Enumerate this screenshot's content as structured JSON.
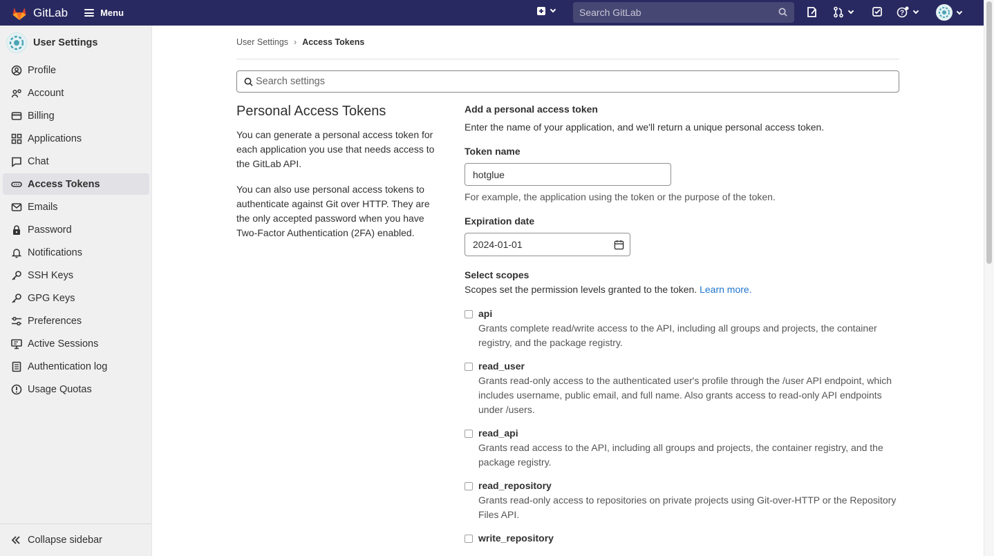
{
  "navbar": {
    "brand": "GitLab",
    "menu_label": "Menu",
    "search_placeholder": "Search GitLab",
    "icons": [
      "plus-square-icon",
      "search-icon",
      "issues-icon",
      "merge-request-icon",
      "todo-icon",
      "help-icon",
      "avatar-icon"
    ]
  },
  "sidebar": {
    "title": "User Settings",
    "items": [
      {
        "label": "Profile",
        "icon": "profile-icon"
      },
      {
        "label": "Account",
        "icon": "account-icon"
      },
      {
        "label": "Billing",
        "icon": "billing-icon"
      },
      {
        "label": "Applications",
        "icon": "applications-icon"
      },
      {
        "label": "Chat",
        "icon": "chat-icon"
      },
      {
        "label": "Access Tokens",
        "icon": "token-icon"
      },
      {
        "label": "Emails",
        "icon": "mail-icon"
      },
      {
        "label": "Password",
        "icon": "lock-icon"
      },
      {
        "label": "Notifications",
        "icon": "bell-icon"
      },
      {
        "label": "SSH Keys",
        "icon": "key-icon"
      },
      {
        "label": "GPG Keys",
        "icon": "key-icon"
      },
      {
        "label": "Preferences",
        "icon": "preferences-icon"
      },
      {
        "label": "Active Sessions",
        "icon": "monitor-icon"
      },
      {
        "label": "Authentication log",
        "icon": "log-icon"
      },
      {
        "label": "Usage Quotas",
        "icon": "quota-icon"
      }
    ],
    "active": "Access Tokens",
    "collapse_label": "Collapse sidebar"
  },
  "breadcrumb": {
    "parent": "User Settings",
    "current": "Access Tokens"
  },
  "settings_search_placeholder": "Search settings",
  "intro": {
    "title": "Personal Access Tokens",
    "p1": "You can generate a personal access token for each application you use that needs access to the GitLab API.",
    "p2": "You can also use personal access tokens to authenticate against Git over HTTP. They are the only accepted password when you have Two-Factor Authentication (2FA) enabled."
  },
  "form": {
    "heading": "Add a personal access token",
    "intro": "Enter the name of your application, and we'll return a unique personal access token.",
    "token_name_label": "Token name",
    "token_name_value": "hotglue",
    "token_name_help": "For example, the application using the token or the purpose of the token.",
    "expiration_label": "Expiration date",
    "expiration_value": "2024-01-01",
    "scopes_heading": "Select scopes",
    "scopes_help": "Scopes set the permission levels granted to the token.",
    "learn_more": "Learn more.",
    "scopes": [
      {
        "name": "api",
        "checked": false,
        "desc": "Grants complete read/write access to the API, including all groups and projects, the container registry, and the package registry."
      },
      {
        "name": "read_user",
        "checked": false,
        "desc": "Grants read-only access to the authenticated user's profile through the /user API endpoint, which includes username, public email, and full name. Also grants access to read-only API endpoints under /users."
      },
      {
        "name": "read_api",
        "checked": false,
        "desc": "Grants read access to the API, including all groups and projects, the container registry, and the package registry."
      },
      {
        "name": "read_repository",
        "checked": false,
        "desc": "Grants read-only access to repositories on private projects using Git-over-HTTP or the Repository Files API."
      },
      {
        "name": "write_repository",
        "checked": false,
        "desc": ""
      }
    ]
  },
  "colors": {
    "navbar": "#292961",
    "sidebar": "#f0f0f0",
    "link": "#1f75cb",
    "logo_orange": "#fc6d26"
  }
}
